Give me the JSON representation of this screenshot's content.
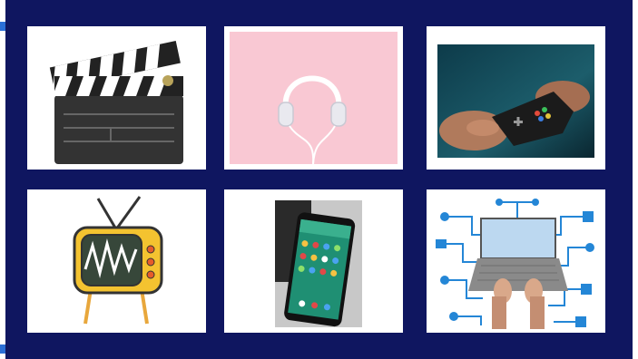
{
  "grid": {
    "tiles": [
      {
        "id": "clapperboard",
        "icon": "clapperboard-icon"
      },
      {
        "id": "headphones",
        "icon": "headphones-icon"
      },
      {
        "id": "game-controller",
        "icon": "game-controller-icon"
      },
      {
        "id": "retro-tv",
        "icon": "tv-icon"
      },
      {
        "id": "smartphone",
        "icon": "smartphone-icon"
      },
      {
        "id": "laptop-network",
        "icon": "laptop-network-icon"
      }
    ]
  },
  "colors": {
    "frame": "#0f1660",
    "tile_bg": "#ffffff",
    "accent": "#2a6fd6"
  }
}
